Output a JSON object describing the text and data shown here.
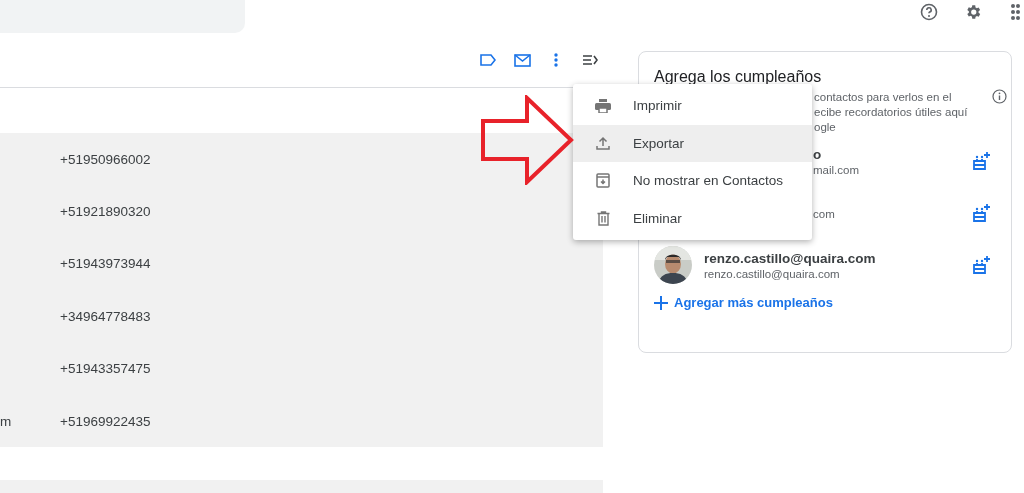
{
  "table": {
    "rows": [
      {
        "phone": "+51950966002"
      },
      {
        "phone": "+51921890320"
      },
      {
        "phone": "+51943973944"
      },
      {
        "phone": "+34964778483"
      },
      {
        "phone": "+51943357475"
      },
      {
        "column_1": "m",
        "phone": "+51969922435"
      }
    ]
  },
  "birthdays_panel": {
    "title": "Agrega los cumpleaños",
    "description_lines": [
      "contactos para verlos en el",
      "ecibe recordatorios útiles aquí",
      "ogle"
    ],
    "contacts": [
      {
        "kind": "partial",
        "name": "o",
        "email": "mail.com"
      },
      {
        "kind": "partial",
        "email": "com"
      },
      {
        "kind": "full",
        "name": "renzo.castillo@quaira.com",
        "email": "renzo.castillo@quaira.com"
      }
    ],
    "add_more": "Agregar más cumpleaños"
  },
  "menu": {
    "items": [
      {
        "label": "Imprimir",
        "highlighted": false
      },
      {
        "label": "Exportar",
        "highlighted": true
      },
      {
        "label": "No mostrar en Contactos",
        "highlighted": false
      },
      {
        "label": "Eliminar",
        "highlighted": false
      }
    ]
  },
  "annotation": {
    "kind": "arrow",
    "color": "#e8222a"
  }
}
